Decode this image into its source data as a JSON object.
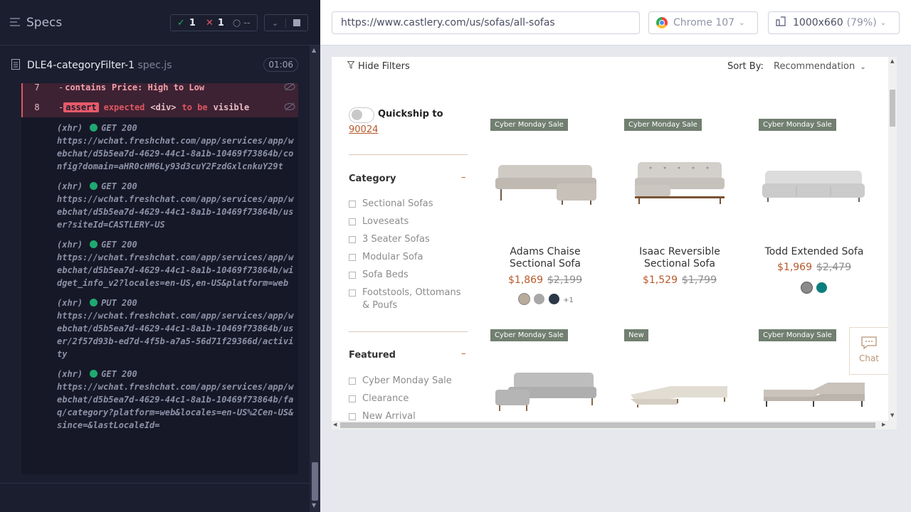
{
  "runner": {
    "specs_label": "Specs",
    "passed_count": "1",
    "failed_count": "1",
    "pending_label": "--",
    "spec_name": "DLE4-categoryFilter-1",
    "spec_ext": "spec.js",
    "timer": "01:06"
  },
  "log": {
    "row7": {
      "num": "7",
      "dash": "-",
      "cmd": "contains",
      "arg": "Price: High to Low"
    },
    "row8": {
      "num": "8",
      "dash": "-",
      "cmd": "assert",
      "w1": "expected",
      "w2": "<div>",
      "w3": "to be",
      "w4": "visible"
    },
    "xhrs": [
      {
        "kind": "(xhr)",
        "status": "GET 200",
        "url": "https://wchat.freshchat.com/app/services/app/webchat/d5b5ea7d-4629-44c1-8a1b-10469f73864b/config?domain=aHR0cHM6Ly93d3cuY2FzdGxlcnkuY29t"
      },
      {
        "kind": "(xhr)",
        "status": "GET 200",
        "url": "https://wchat.freshchat.com/app/services/app/webchat/d5b5ea7d-4629-44c1-8a1b-10469f73864b/user?siteId=CASTLERY-US"
      },
      {
        "kind": "(xhr)",
        "status": "GET 200",
        "url": "https://wchat.freshchat.com/app/services/app/webchat/d5b5ea7d-4629-44c1-8a1b-10469f73864b/widget_info_v2?locales=en-US,en-US&platform=web"
      },
      {
        "kind": "(xhr)",
        "status": "PUT 200",
        "url": "https://wchat.freshchat.com/app/services/app/webchat/d5b5ea7d-4629-44c1-8a1b-10469f73864b/user/2f57d93b-ed7d-4f5b-a7a5-56d71f29366d/activity"
      },
      {
        "kind": "(xhr)",
        "status": "GET 200",
        "url": "https://wchat.freshchat.com/app/services/app/webchat/d5b5ea7d-4629-44c1-8a1b-10469f73864b/faq/category?platform=web&locales=en-US%2Cen-US&since=&lastLocaleId="
      }
    ]
  },
  "browser": {
    "url": "https://www.castlery.com/us/sofas/all-sofas",
    "name": "Chrome 107",
    "viewport": "1000x660",
    "zoom": "(79%)"
  },
  "site": {
    "hide_filters": "Hide Filters",
    "sort_by_label": "Sort By:",
    "sort_value": "Recommendation",
    "quickship_label": "Quickship to",
    "zip": "90024",
    "category_title": "Category",
    "categories": [
      "Sectional Sofas",
      "Loveseats",
      "3 Seater Sofas",
      "Modular Sofa",
      "Sofa Beds",
      "Footstools, Ottomans & Poufs"
    ],
    "featured_title": "Featured",
    "featured": [
      "Cyber Monday Sale",
      "Clearance",
      "New Arrival"
    ],
    "chat_label": "Chat",
    "products": [
      {
        "badge": "Cyber Monday Sale",
        "name": "Adams Chaise Sectional Sofa",
        "price": "$1,869",
        "was": "$2,199",
        "more": "+1"
      },
      {
        "badge": "Cyber Monday Sale",
        "name": "Isaac Reversible Sectional Sofa",
        "price": "$1,529",
        "was": "$1,799"
      },
      {
        "badge": "Cyber Monday Sale",
        "name": "Todd Extended Sofa",
        "price": "$1,969",
        "was": "$2,479"
      },
      {
        "badge": "Cyber Monday Sale"
      },
      {
        "badge": "New"
      },
      {
        "badge": "Cyber Monday Sale"
      }
    ],
    "colors": {
      "accent": "#b75a2b",
      "badge": "#717f70"
    }
  }
}
